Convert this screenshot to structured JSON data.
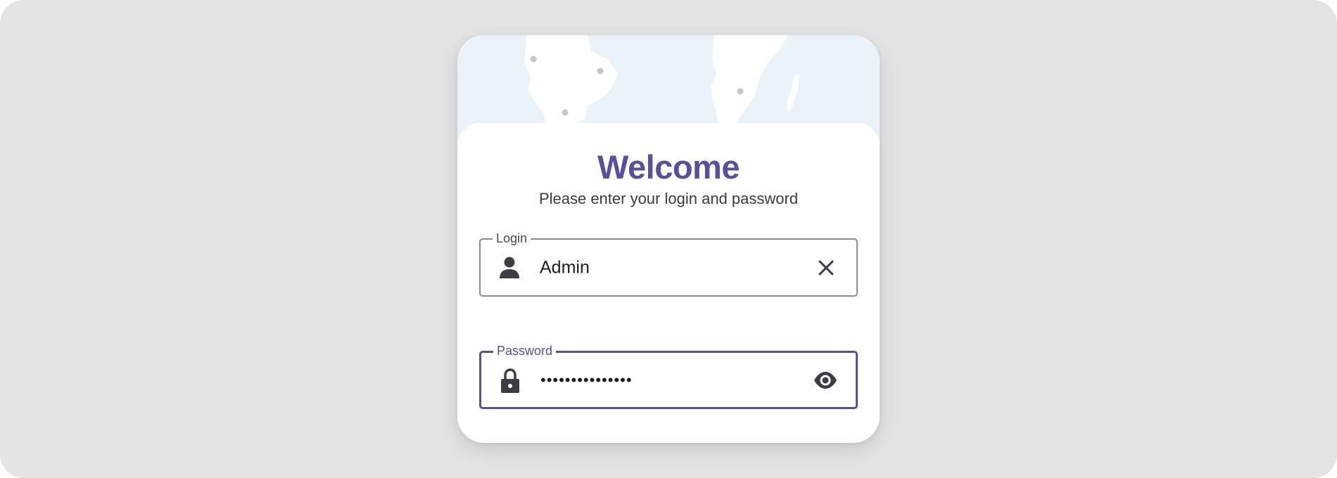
{
  "form": {
    "title": "Welcome",
    "subtitle": "Please enter your login and password"
  },
  "login_field": {
    "label": "Login",
    "value": "Admin",
    "lead_icon": "person-icon",
    "trail_icon": "clear-icon"
  },
  "password_field": {
    "label": "Password",
    "value": "•••••••••••••••",
    "lead_icon": "lock-icon",
    "trail_icon": "eye-icon",
    "focused": true
  },
  "colors": {
    "accent": "#5b4d9f",
    "map_background": "#eaf3f9",
    "frame_background": "#e4e4e4"
  }
}
